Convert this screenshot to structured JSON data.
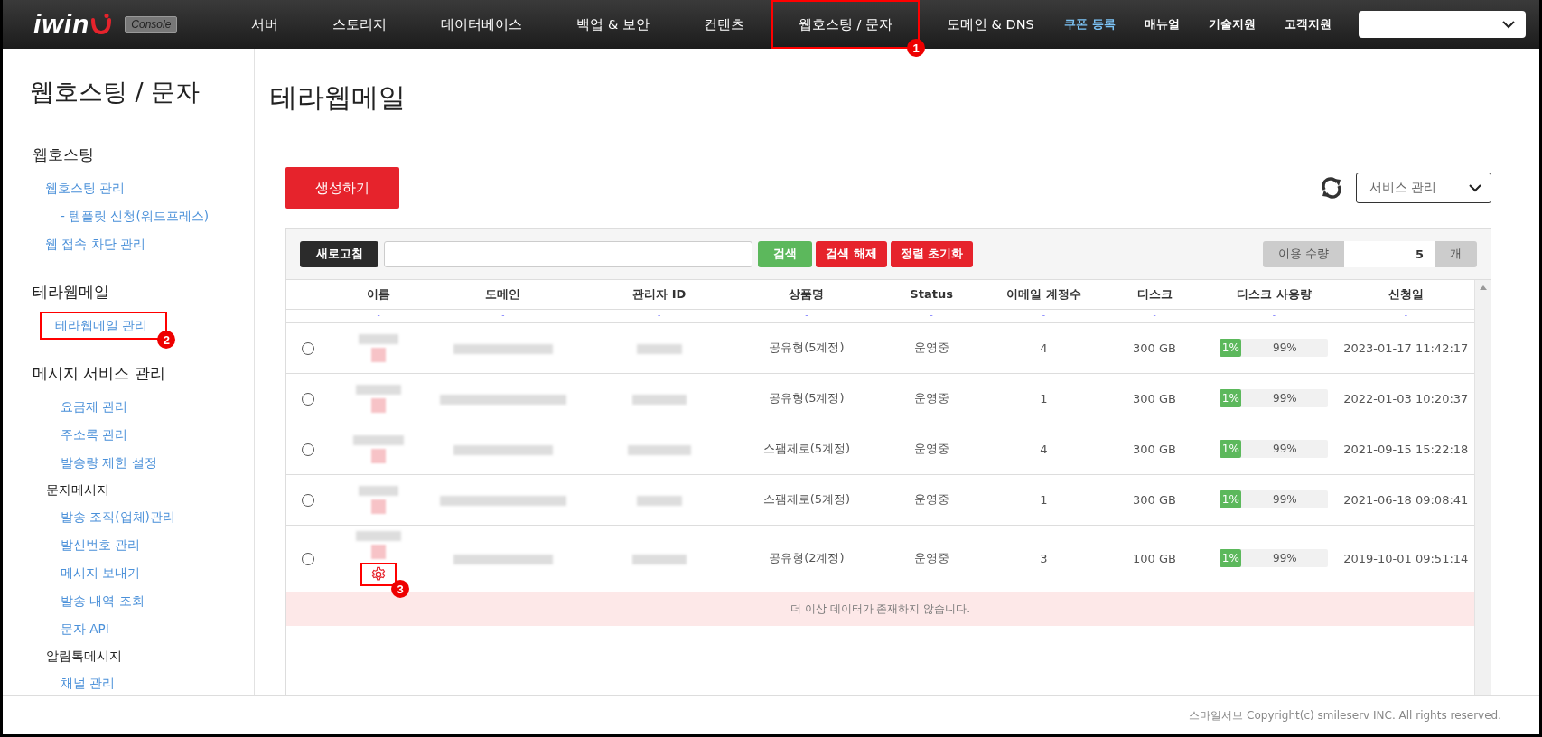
{
  "header": {
    "logo": "iwin",
    "badge": "Console",
    "nav": [
      {
        "label": "서버",
        "selected": false
      },
      {
        "label": "스토리지",
        "selected": false
      },
      {
        "label": "데이터베이스",
        "selected": false
      },
      {
        "label": "백업 & 보안",
        "selected": false
      },
      {
        "label": "컨텐츠",
        "selected": false
      },
      {
        "label": "웹호스팅 / 문자",
        "selected": false,
        "callout": "1"
      },
      {
        "label": "도메인 & DNS",
        "selected": false
      }
    ],
    "links": [
      {
        "label": "쿠폰 등록",
        "highlighted": true
      },
      {
        "label": "매뉴얼",
        "highlighted": false
      },
      {
        "label": "기술지원",
        "highlighted": false
      },
      {
        "label": "고객지원",
        "highlighted": false
      }
    ]
  },
  "sidebar": {
    "title": "웹호스팅 / 문자",
    "sections": [
      {
        "title": "웹호스팅",
        "items": [
          {
            "kind": "link",
            "label": "웹호스팅 관리",
            "children": [
              {
                "kind": "link",
                "label": "- 템플릿 신청(워드프레스)"
              }
            ]
          },
          {
            "kind": "link",
            "label": "웹 접속 차단 관리"
          }
        ]
      },
      {
        "title": "테라웹메일",
        "items": [
          {
            "kind": "link",
            "label": "테라웹메일 관리",
            "callout": "2"
          }
        ]
      },
      {
        "title": "메시지 서비스 관리",
        "items": [
          {
            "kind": "link",
            "label": "요금제 관리"
          },
          {
            "kind": "link",
            "label": "주소록 관리"
          },
          {
            "kind": "link",
            "label": "발송량 제한 설정"
          },
          {
            "kind": "group",
            "label": "문자메시지",
            "children": [
              {
                "kind": "link",
                "label": "발송 조직(업체)관리"
              },
              {
                "kind": "link",
                "label": "발신번호 관리"
              },
              {
                "kind": "link",
                "label": "메시지 보내기"
              },
              {
                "kind": "link",
                "label": "발송 내역 조회"
              },
              {
                "kind": "link",
                "label": "문자 API"
              }
            ]
          },
          {
            "kind": "group",
            "label": "알림톡메시지",
            "children": [
              {
                "kind": "link",
                "label": "채널 관리"
              }
            ]
          }
        ]
      }
    ]
  },
  "page_title": "테라웹메일",
  "create_button": "생성하기",
  "service_select": {
    "value": "서비스 관리"
  },
  "toolbar": {
    "buttons": [
      {
        "label": "새로고침",
        "kind": "dark"
      }
    ],
    "actions": [
      {
        "label": "검색",
        "kind": "green"
      },
      {
        "label": "검색 해제",
        "kind": "red"
      },
      {
        "label": "정렬 초기화",
        "kind": "red"
      }
    ],
    "quantity": {
      "label": "이용 수량",
      "value": "5",
      "unit": "개"
    }
  },
  "table": {
    "columns": [
      {
        "label": "이름",
        "sort": "-"
      },
      {
        "label": "도메인",
        "sort": "-"
      },
      {
        "label": "관리자 ID",
        "sort": "-"
      },
      {
        "label": "상품명",
        "sort": "-"
      },
      {
        "label": "Status",
        "sort": "-"
      },
      {
        "label": "이메일 계정수",
        "sort": "-"
      },
      {
        "label": "디스크",
        "sort": "-"
      },
      {
        "label": "디스크 사용량",
        "sort": "-"
      },
      {
        "label": "신청일",
        "sort": "-"
      }
    ],
    "rows": [
      {
        "selected": false,
        "product": "공유형(5계정)",
        "status": "운영중",
        "accounts": "4",
        "disk": "300 GB",
        "used": "1%",
        "free": "99%",
        "level": 0.01,
        "date": "2023-01-17 11:42:17",
        "settings": false
      },
      {
        "selected": false,
        "product": "공유형(5계정)",
        "status": "운영중",
        "accounts": "1",
        "disk": "300 GB",
        "used": "1%",
        "free": "99%",
        "level": 0.01,
        "date": "2022-01-03 10:20:37",
        "settings": false
      },
      {
        "selected": false,
        "product": "스팸제로(5계정)",
        "status": "운영중",
        "accounts": "4",
        "disk": "300 GB",
        "used": "1%",
        "free": "99%",
        "level": 0.01,
        "date": "2021-09-15 15:22:18",
        "settings": false
      },
      {
        "selected": false,
        "product": "스팸제로(5계정)",
        "status": "운영중",
        "accounts": "1",
        "disk": "300 GB",
        "used": "1%",
        "free": "99%",
        "level": 0.01,
        "date": "2021-06-18 09:08:41",
        "settings": false
      },
      {
        "selected": false,
        "product": "공유형(2계정)",
        "status": "운영중",
        "accounts": "3",
        "disk": "100 GB",
        "used": "1%",
        "free": "99%",
        "level": 0.01,
        "date": "2019-10-01 09:51:14",
        "settings": true,
        "callout": "3"
      }
    ],
    "empty_message": "더 이상 데이터가 존재하지 않습니다."
  },
  "footer": "스마일서브 Copyright(c) smileserv INC. All rights reserved."
}
